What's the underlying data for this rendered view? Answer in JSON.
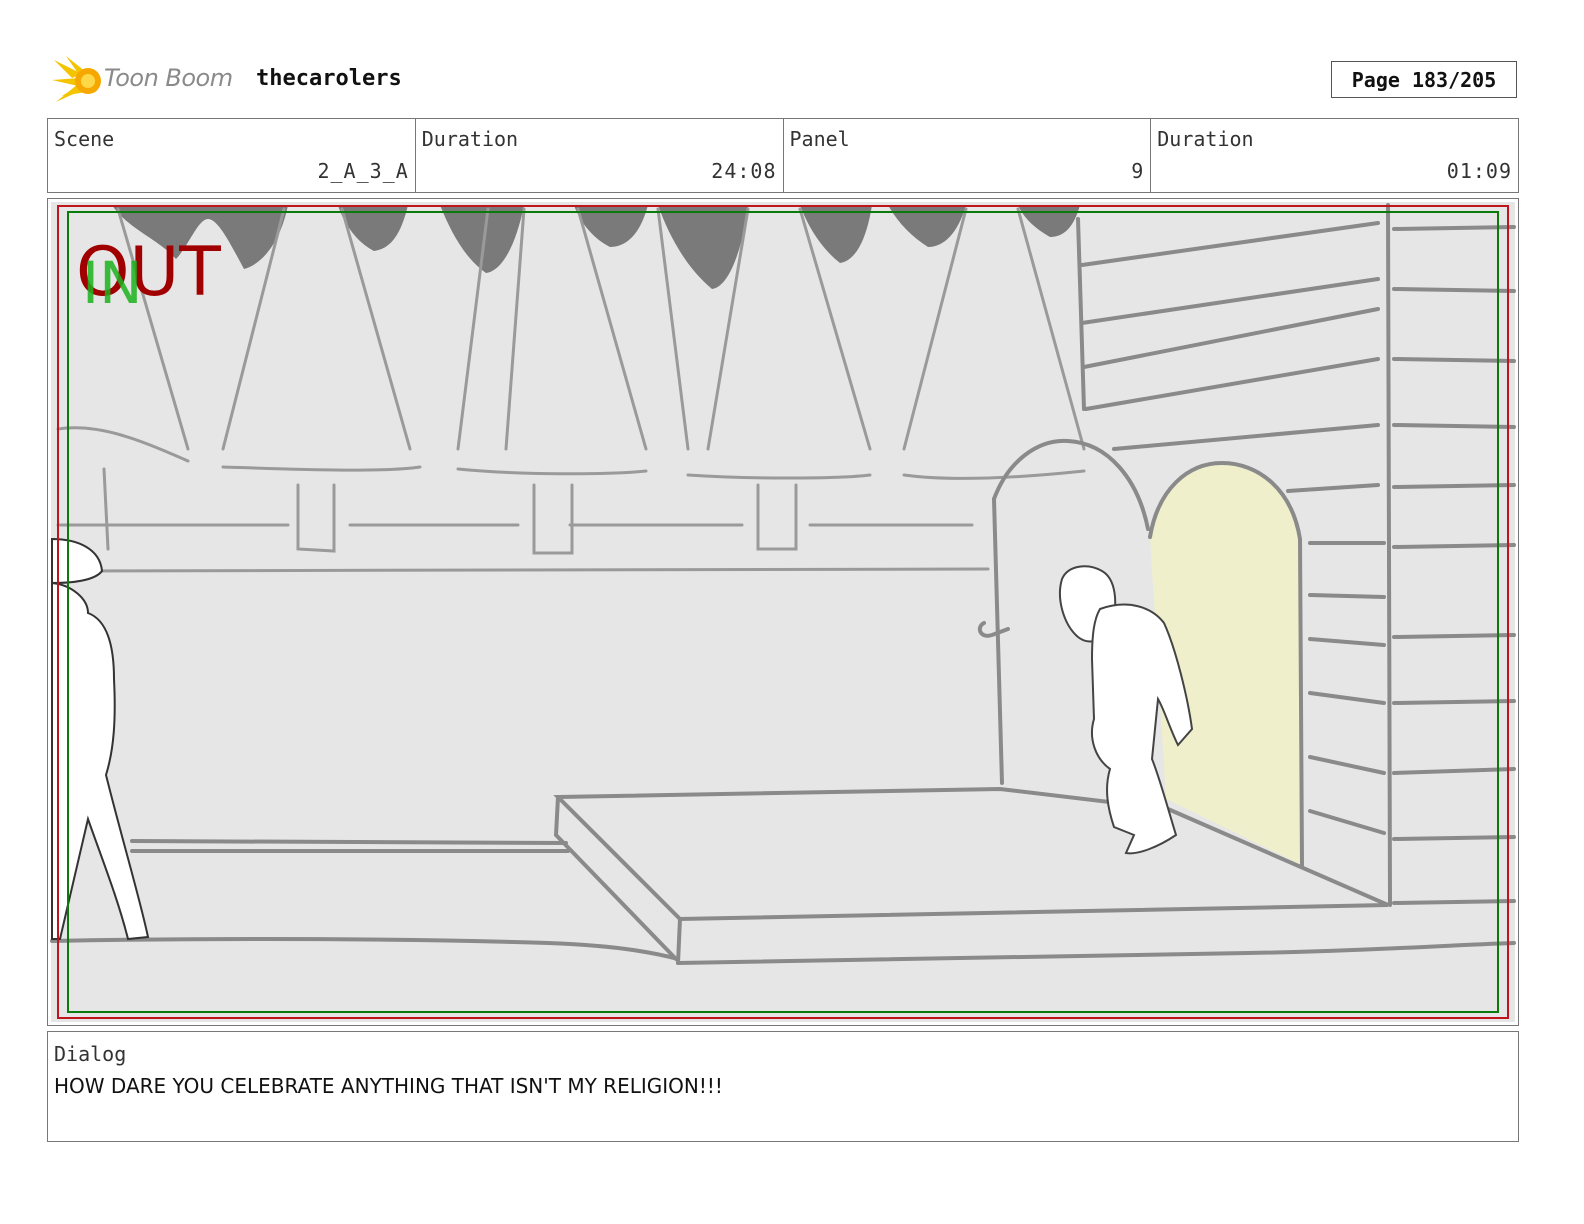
{
  "header": {
    "logo_text": "Toon Boom",
    "project_name": "thecarolers",
    "page_label": "Page 183/205"
  },
  "info": {
    "scene_label": "Scene",
    "scene_value": "2_A_3_A",
    "scene_duration_label": "Duration",
    "scene_duration_value": "24:08",
    "panel_label": "Panel",
    "panel_value": "9",
    "panel_duration_label": "Duration",
    "panel_duration_value": "01:09"
  },
  "panel": {
    "overlay_out": "OUT",
    "overlay_in": "IN",
    "colors": {
      "out_text": "#a00000",
      "in_text": "#1db31d",
      "safe_red": "#c0141e",
      "safe_green": "#0a7a0a",
      "background": "#e6e6e6",
      "doorway": "#efefcb"
    }
  },
  "dialog": {
    "label": "Dialog",
    "text": "HOW DARE YOU CELEBRATE ANYTHING THAT ISN'T MY RELIGION!!!"
  }
}
